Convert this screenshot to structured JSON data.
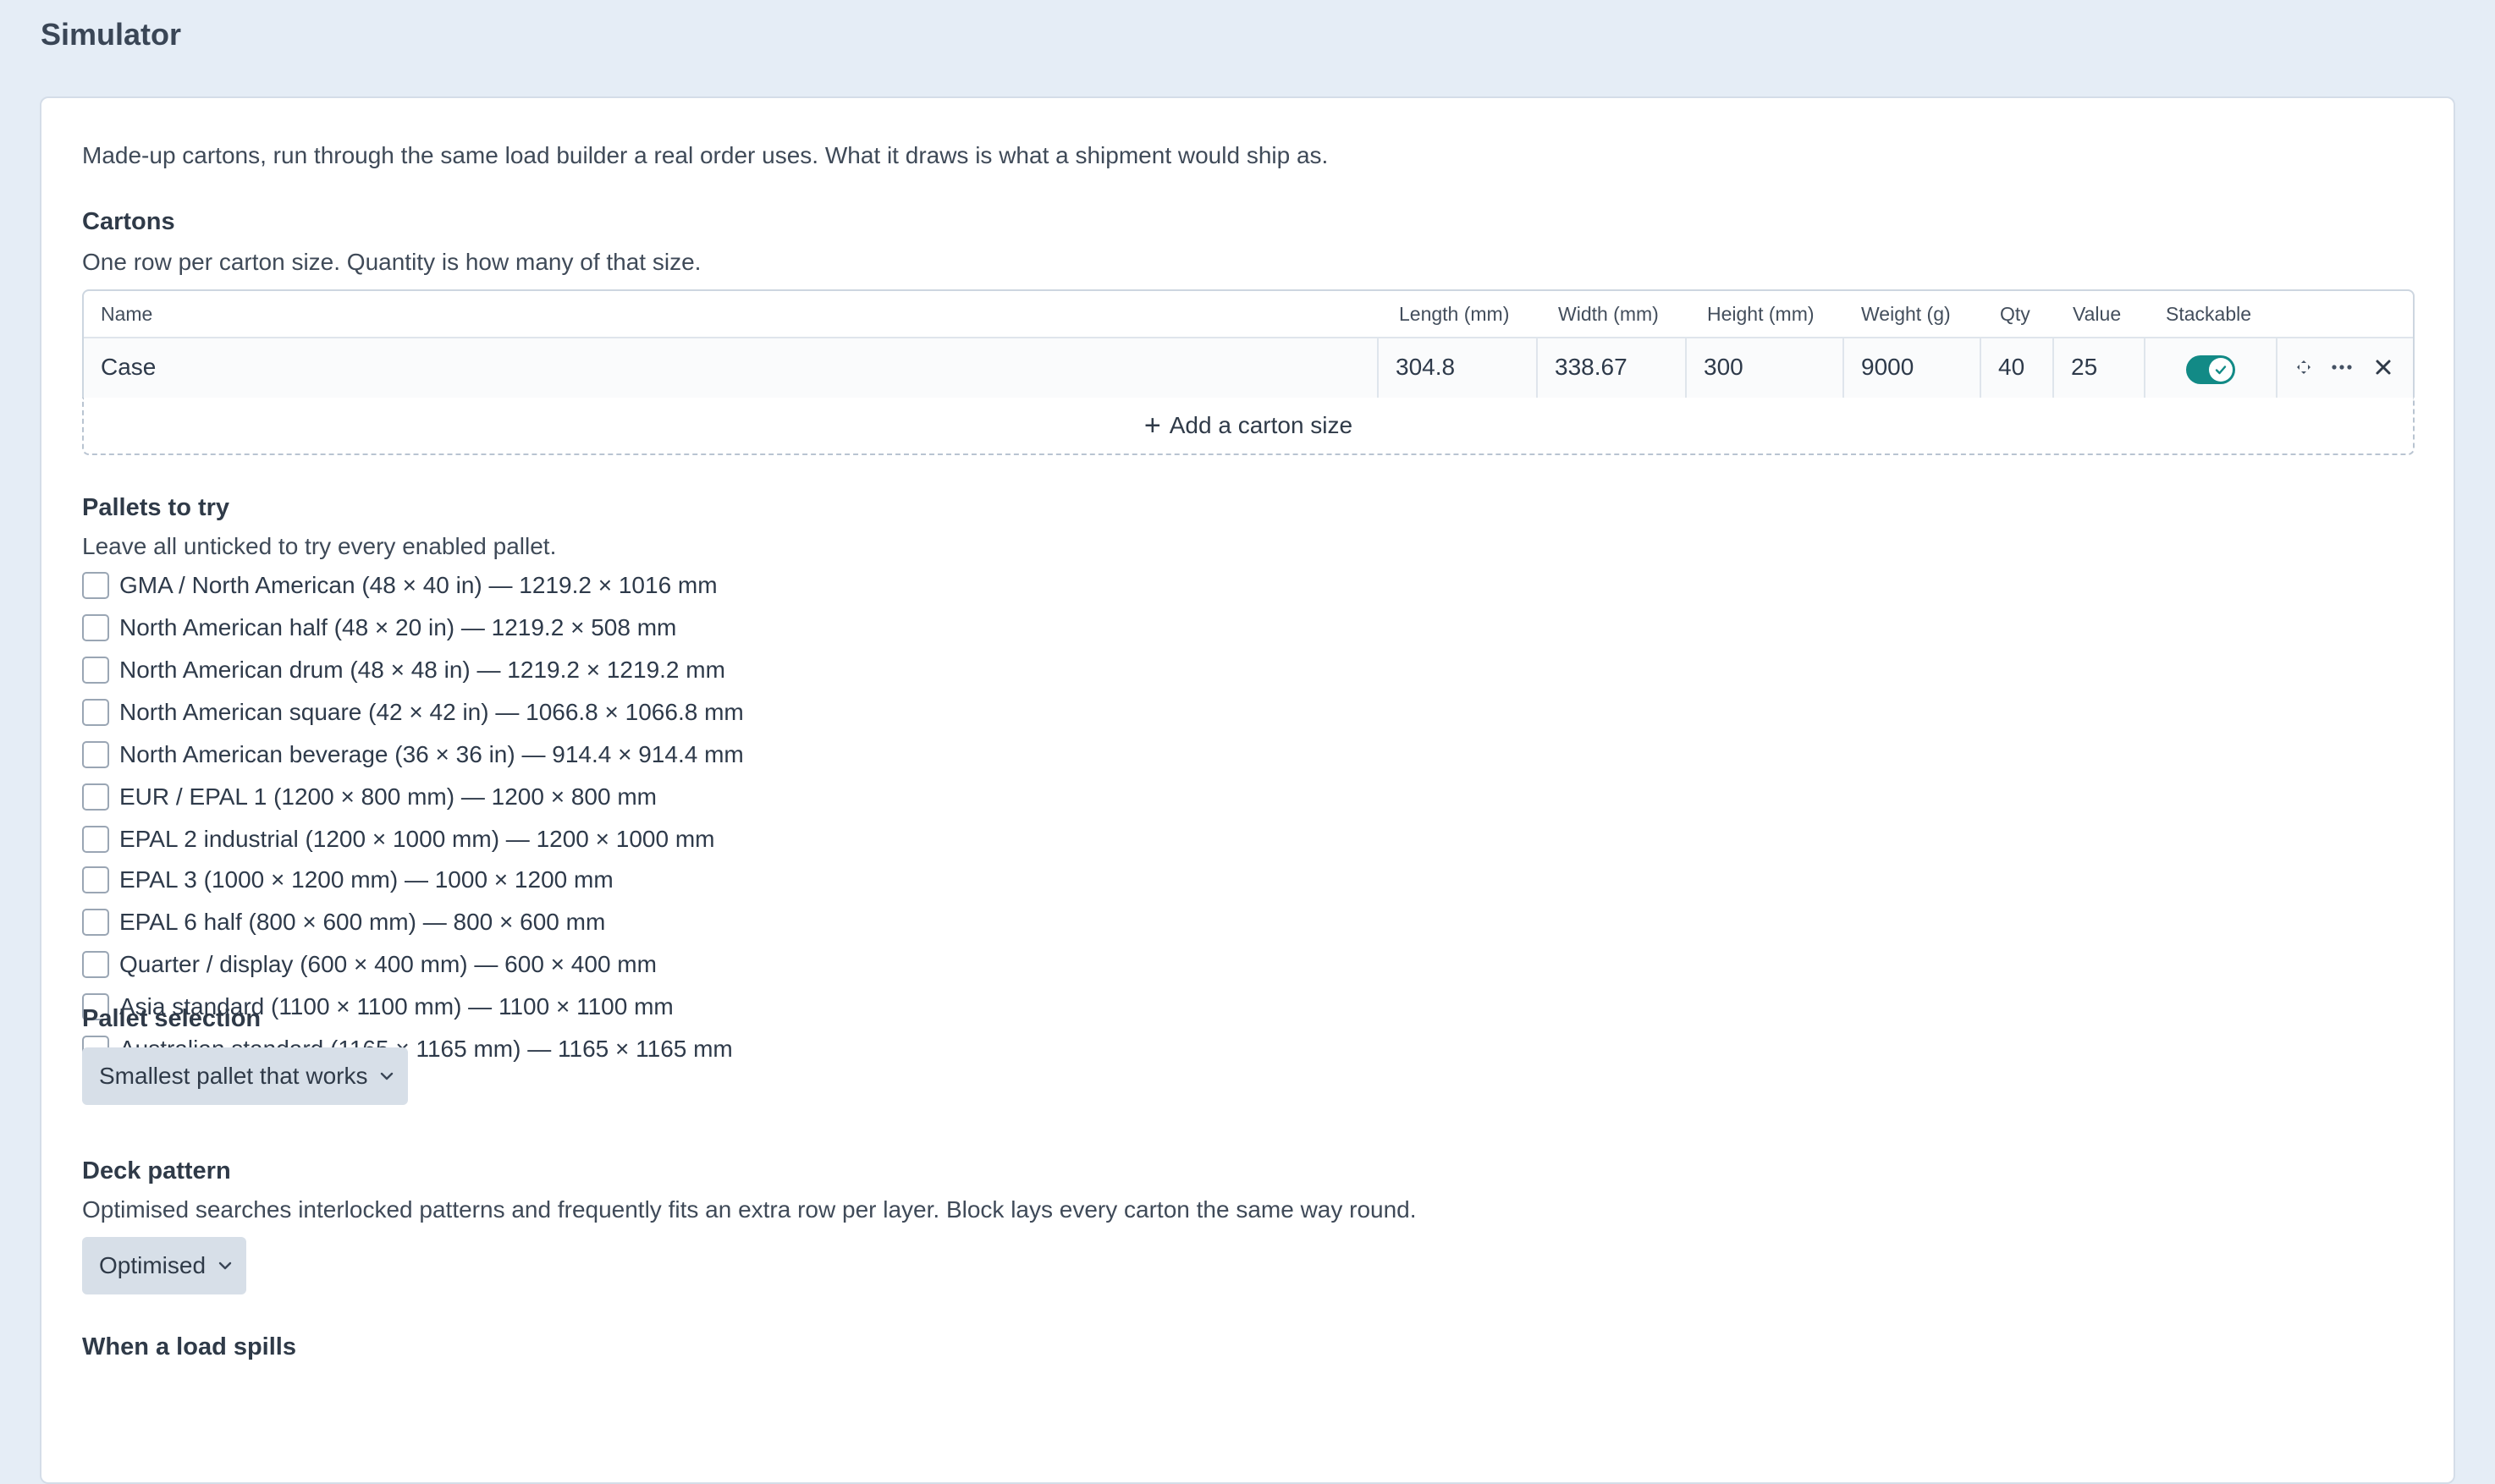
{
  "page": {
    "title": "Simulator"
  },
  "intro": "Made-up cartons, run through the same load builder a real order uses. What it draws is what a shipment would ship as.",
  "cartons": {
    "title": "Cartons",
    "help": "One row per carton size. Quantity is how many of that size.",
    "columns": [
      "Name",
      "Length (mm)",
      "Width (mm)",
      "Height (mm)",
      "Weight (g)",
      "Qty",
      "Value",
      "Stackable"
    ],
    "rows": [
      {
        "name": "Case",
        "length": "304.8",
        "width": "338.67",
        "height": "300",
        "weight": "9000",
        "qty": "40",
        "value": "25",
        "stackable": true
      }
    ],
    "add_label": "Add a carton size",
    "toggle_color": "#128a86"
  },
  "pallets": {
    "title": "Pallets to try",
    "help": "Leave all unticked to try every enabled pallet.",
    "items": [
      "GMA / North American (48 × 40 in) — 1219.2 × 1016 mm",
      "North American half (48 × 20 in) — 1219.2 × 508 mm",
      "North American drum (48 × 48 in) — 1219.2 × 1219.2 mm",
      "North American square (42 × 42 in) — 1066.8 × 1066.8 mm",
      "North American beverage (36 × 36 in) — 914.4 × 914.4 mm",
      "EUR / EPAL 1 (1200 × 800 mm) — 1200 × 800 mm",
      "EPAL 2 industrial (1200 × 1000 mm) — 1200 × 1000 mm",
      "EPAL 3 (1000 × 1200 mm) — 1000 × 1200 mm",
      "EPAL 6 half (800 × 600 mm) — 800 × 600 mm",
      "Quarter / display (600 × 400 mm) — 600 × 400 mm",
      "Asia standard (1100 × 1100 mm) — 1100 × 1100 mm",
      "Australian standard (1165 × 1165 mm) — 1165 × 1165 mm"
    ]
  },
  "pallet_selection": {
    "title": "Pallet selection",
    "value": "Smallest pallet that works"
  },
  "deck_pattern": {
    "title": "Deck pattern",
    "help": "Optimised searches interlocked patterns and frequently fits an extra row per layer. Block lays every carton the same way round.",
    "value": "Optimised"
  },
  "spill": {
    "title": "When a load spills"
  }
}
